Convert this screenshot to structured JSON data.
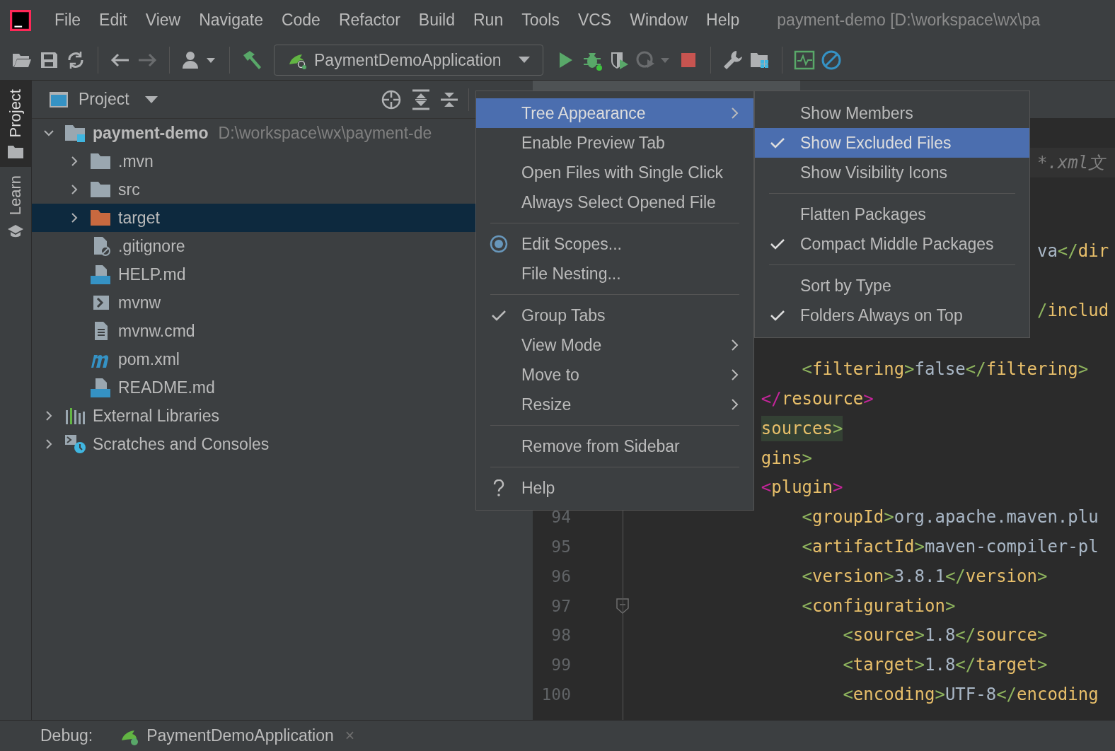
{
  "menu_bar": {
    "items": [
      "File",
      "Edit",
      "View",
      "Navigate",
      "Code",
      "Refactor",
      "Build",
      "Run",
      "Tools",
      "VCS",
      "Window",
      "Help"
    ],
    "title": "payment-demo [D:\\workspace\\wx\\pa"
  },
  "toolbar": [
    {
      "kind": "open",
      "disabled": false
    },
    {
      "kind": "save",
      "disabled": false
    },
    {
      "kind": "sync",
      "disabled": false
    },
    {
      "kind": "sep"
    },
    {
      "kind": "back",
      "disabled": false
    },
    {
      "kind": "forward",
      "disabled": true
    },
    {
      "kind": "sep"
    },
    {
      "kind": "user",
      "disabled": false
    },
    {
      "kind": "sep"
    },
    {
      "kind": "build",
      "disabled": false
    },
    {
      "kind": "config",
      "label": "PaymentDemoApplication"
    },
    {
      "kind": "run",
      "disabled": false
    },
    {
      "kind": "debug",
      "disabled": false
    },
    {
      "kind": "coverage",
      "disabled": false
    },
    {
      "kind": "profile",
      "disabled": true
    },
    {
      "kind": "stop",
      "disabled": false
    },
    {
      "kind": "sep"
    },
    {
      "kind": "wrench",
      "disabled": false
    },
    {
      "kind": "structure",
      "disabled": false
    },
    {
      "kind": "sep"
    },
    {
      "kind": "monitor",
      "disabled": false
    },
    {
      "kind": "prohibit",
      "disabled": false
    }
  ],
  "side_strip": [
    {
      "label": "Project",
      "kind": "folder",
      "selected": true
    },
    {
      "label": "Learn",
      "kind": "cap",
      "selected": false
    }
  ],
  "project_panel": {
    "title": "Project",
    "tree": [
      {
        "name": "payment-demo",
        "path": "D:\\workspace\\wx\\payment-de",
        "kind": "module",
        "expanded": true,
        "selected": false,
        "children": [
          {
            "name": ".mvn",
            "kind": "folder",
            "expanded": false,
            "selected": false
          },
          {
            "name": "src",
            "kind": "folder",
            "expanded": false,
            "selected": false
          },
          {
            "name": "target",
            "kind": "excluded",
            "expanded": false,
            "selected": true
          },
          {
            "name": ".gitignore",
            "kind": "ignore",
            "selected": false
          },
          {
            "name": "HELP.md",
            "kind": "md",
            "selected": false
          },
          {
            "name": "mvnw",
            "kind": "shell",
            "selected": false
          },
          {
            "name": "mvnw.cmd",
            "kind": "text",
            "selected": false
          },
          {
            "name": "pom.xml",
            "kind": "maven",
            "selected": false
          },
          {
            "name": "README.md",
            "kind": "md",
            "selected": false
          }
        ]
      },
      {
        "name": "External Libraries",
        "kind": "libraries",
        "expanded": false,
        "selected": false
      },
      {
        "name": "Scratches and Consoles",
        "kind": "scratches",
        "expanded": false,
        "selected": false
      }
    ]
  },
  "editor": {
    "lines": [
      {
        "band": true,
        "code": [
          {
            "kind": "comment",
            "text": "*.xml文"
          }
        ]
      },
      {
        "code": [
          {
            "kind": "value",
            "text": "va"
          },
          {
            "kind": "bracket",
            "text": "</"
          },
          {
            "kind": "tag",
            "text": "dir"
          }
        ]
      },
      {
        "code": [
          {
            "kind": "bracket",
            "text": "/"
          },
          {
            "kind": "tag",
            "text": "includ"
          }
        ]
      },
      {
        "code": [
          {
            "kind": "bracket",
            "text": "<"
          },
          {
            "kind": "tag",
            "text": "filtering"
          },
          {
            "kind": "bracket",
            "text": ">"
          },
          {
            "kind": "value",
            "text": "false"
          },
          {
            "kind": "bracket",
            "text": "</"
          },
          {
            "kind": "tag",
            "text": "filtering"
          },
          {
            "kind": "bracket",
            "text": ">"
          }
        ]
      },
      {
        "code": [
          {
            "kind": "match",
            "text": "</"
          },
          {
            "kind": "tag",
            "text": "resource"
          },
          {
            "kind": "match",
            "text": ">"
          }
        ]
      },
      {
        "highlighted": true,
        "code": [
          {
            "kind": "tag",
            "text": "sources"
          },
          {
            "kind": "bracket",
            "text": ">"
          }
        ]
      },
      {
        "code": [
          {
            "kind": "tag",
            "text": "gins"
          },
          {
            "kind": "bracket",
            "text": ">"
          }
        ]
      },
      {
        "code": [
          {
            "kind": "match",
            "text": "<"
          },
          {
            "kind": "tag",
            "text": "plugin"
          },
          {
            "kind": "match",
            "text": ">"
          }
        ]
      },
      {
        "number": "94",
        "code": [
          {
            "kind": "bracket",
            "text": "<"
          },
          {
            "kind": "tag",
            "text": "groupId"
          },
          {
            "kind": "bracket",
            "text": ">"
          },
          {
            "kind": "value",
            "text": "org.apache.maven.plu"
          }
        ]
      },
      {
        "number": "95",
        "code": [
          {
            "kind": "bracket",
            "text": "<"
          },
          {
            "kind": "tag",
            "text": "artifactId"
          },
          {
            "kind": "bracket",
            "text": ">"
          },
          {
            "kind": "value",
            "text": "maven-compiler-pl"
          }
        ]
      },
      {
        "number": "96",
        "code": [
          {
            "kind": "bracket",
            "text": "<"
          },
          {
            "kind": "tag",
            "text": "version"
          },
          {
            "kind": "bracket",
            "text": ">"
          },
          {
            "kind": "value",
            "text": "3.8.1"
          },
          {
            "kind": "bracket",
            "text": "</"
          },
          {
            "kind": "tag",
            "text": "version"
          },
          {
            "kind": "bracket",
            "text": ">"
          }
        ]
      },
      {
        "number": "97",
        "fold": true,
        "code": [
          {
            "kind": "bracket",
            "text": "<"
          },
          {
            "kind": "tag",
            "text": "configuration"
          },
          {
            "kind": "bracket",
            "text": ">"
          }
        ]
      },
      {
        "number": "98",
        "code": [
          {
            "kind": "bracket",
            "text": "<"
          },
          {
            "kind": "tag",
            "text": "source"
          },
          {
            "kind": "bracket",
            "text": ">"
          },
          {
            "kind": "value",
            "text": "1.8"
          },
          {
            "kind": "bracket",
            "text": "</"
          },
          {
            "kind": "tag",
            "text": "source"
          },
          {
            "kind": "bracket",
            "text": ">"
          }
        ]
      },
      {
        "number": "99",
        "code": [
          {
            "kind": "bracket",
            "text": "<"
          },
          {
            "kind": "tag",
            "text": "target"
          },
          {
            "kind": "bracket",
            "text": ">"
          },
          {
            "kind": "value",
            "text": "1.8"
          },
          {
            "kind": "bracket",
            "text": "</"
          },
          {
            "kind": "tag",
            "text": "target"
          },
          {
            "kind": "bracket",
            "text": ">"
          }
        ]
      },
      {
        "number": "100",
        "code": [
          {
            "kind": "bracket",
            "text": "<"
          },
          {
            "kind": "tag",
            "text": "encoding"
          },
          {
            "kind": "bracket",
            "text": ">"
          },
          {
            "kind": "value",
            "text": "UTF-8"
          },
          {
            "kind": "bracket",
            "text": "</"
          },
          {
            "kind": "tag",
            "text": "encoding"
          }
        ]
      }
    ]
  },
  "context_menu": [
    {
      "kind": "item",
      "label": "Tree Appearance",
      "selected": true,
      "checked": false,
      "submenu": true
    },
    {
      "kind": "item",
      "label": "Enable Preview Tab",
      "selected": false,
      "checked": false,
      "submenu": false
    },
    {
      "kind": "item",
      "label": "Open Files with Single Click",
      "selected": false,
      "checked": false,
      "submenu": false
    },
    {
      "kind": "item",
      "label": "Always Select Opened File",
      "selected": false,
      "checked": false,
      "submenu": false
    },
    {
      "kind": "separator"
    },
    {
      "kind": "scopes",
      "label": "Edit Scopes...",
      "selected": false,
      "checked": false,
      "submenu": false
    },
    {
      "kind": "item",
      "label": "File Nesting...",
      "selected": false,
      "checked": false,
      "submenu": false
    },
    {
      "kind": "separator"
    },
    {
      "kind": "item",
      "label": "Group Tabs",
      "selected": false,
      "checked": true,
      "submenu": false
    },
    {
      "kind": "item",
      "label": "View Mode",
      "selected": false,
      "checked": false,
      "submenu": true
    },
    {
      "kind": "item",
      "label": "Move to",
      "selected": false,
      "checked": false,
      "submenu": true
    },
    {
      "kind": "item",
      "label": "Resize",
      "selected": false,
      "checked": false,
      "submenu": true
    },
    {
      "kind": "separator"
    },
    {
      "kind": "item",
      "label": "Remove from Sidebar",
      "selected": false,
      "checked": false,
      "submenu": false
    },
    {
      "kind": "separator"
    },
    {
      "kind": "help",
      "label": "Help",
      "selected": false,
      "checked": false,
      "submenu": false
    }
  ],
  "submenu": [
    {
      "kind": "item",
      "label": "Show Members",
      "selected": false,
      "checked": false
    },
    {
      "kind": "item",
      "label": "Show Excluded Files",
      "selected": true,
      "checked": true
    },
    {
      "kind": "item",
      "label": "Show Visibility Icons",
      "selected": false,
      "checked": false
    },
    {
      "kind": "separator"
    },
    {
      "kind": "item",
      "label": "Flatten Packages",
      "selected": false,
      "checked": false
    },
    {
      "kind": "item",
      "label": "Compact Middle Packages",
      "selected": false,
      "checked": true
    },
    {
      "kind": "separator"
    },
    {
      "kind": "item",
      "label": "Sort by Type",
      "selected": false,
      "checked": false
    },
    {
      "kind": "item",
      "label": "Folders Always on Top",
      "selected": false,
      "checked": true
    }
  ],
  "bottom_bar": {
    "label": "Debug:",
    "tab": "PaymentDemoApplication",
    "close": "×"
  }
}
